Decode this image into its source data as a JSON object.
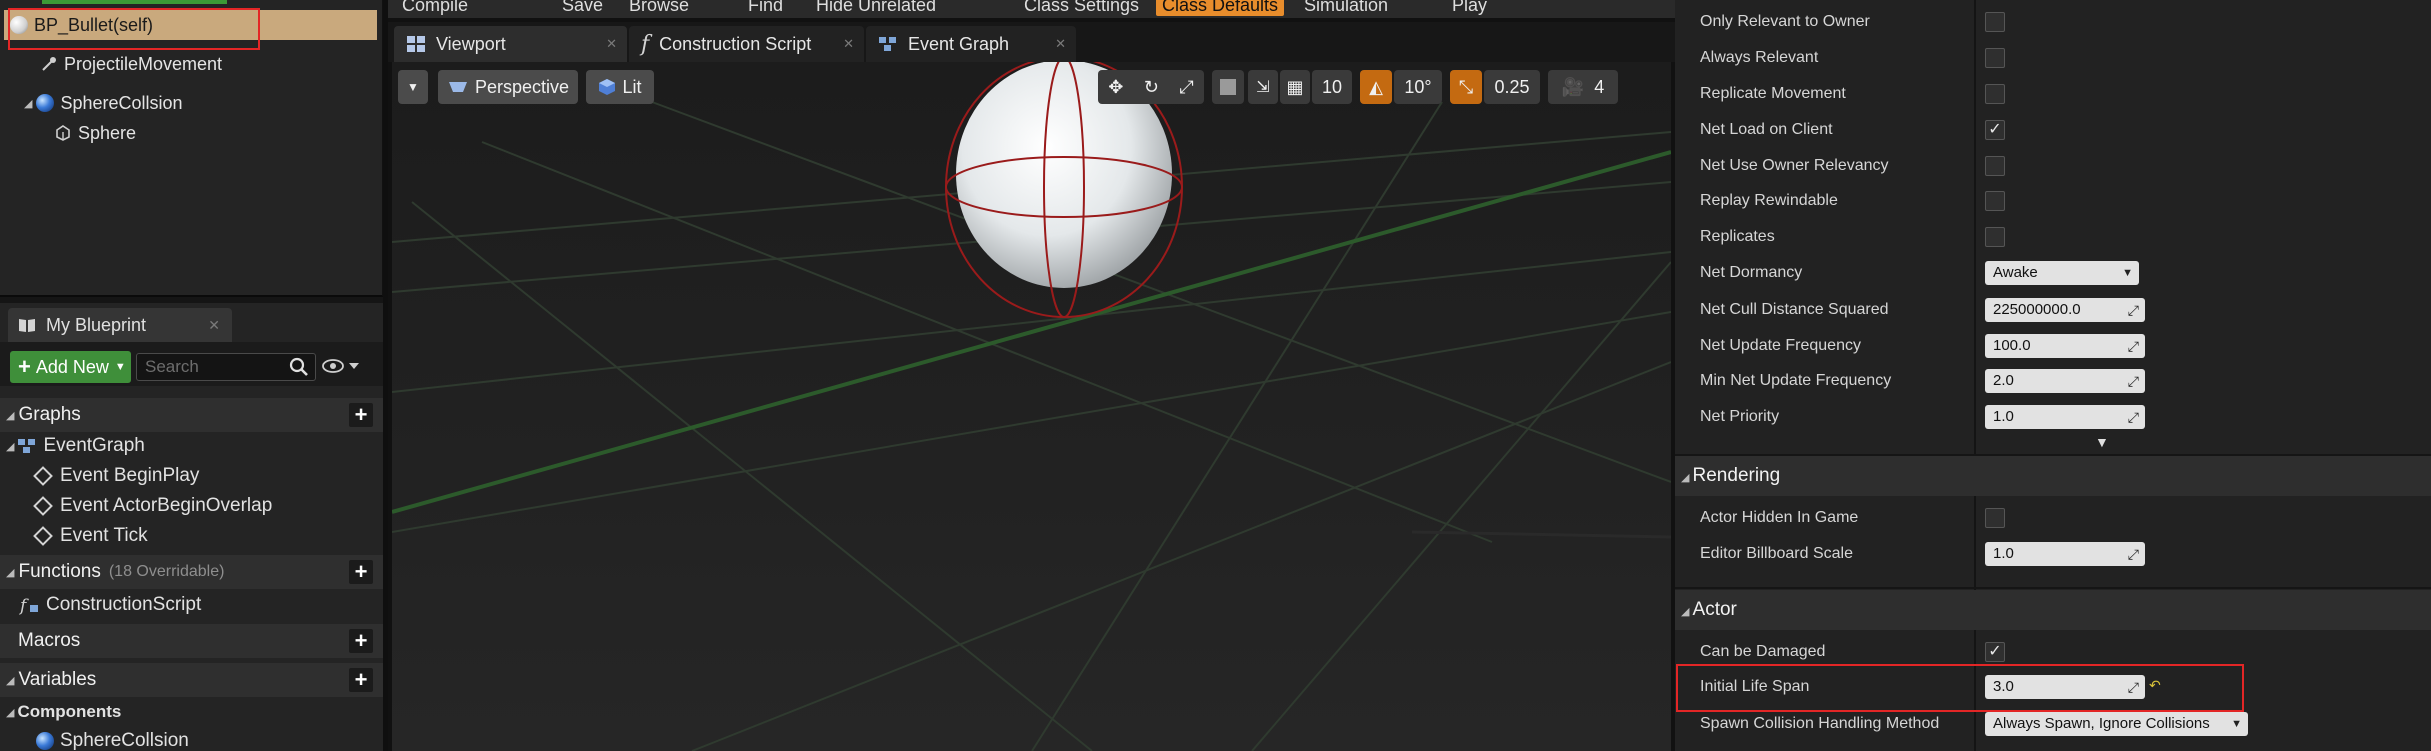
{
  "components": {
    "root": "BP_Bullet(self)",
    "items": [
      {
        "label": "ProjectileMovement"
      },
      {
        "label": "SphereCollsion"
      },
      {
        "label": "Sphere"
      }
    ]
  },
  "top_toolbar": {
    "buttons": [
      "Compile",
      "Save",
      "Browse",
      "Find",
      "Hide Unrelated",
      "Class Settings",
      "Class Defaults",
      "Simulation",
      "Play"
    ]
  },
  "editor_tabs": [
    {
      "label": "Viewport"
    },
    {
      "label": "Construction Script"
    },
    {
      "label": "Event Graph"
    }
  ],
  "viewport_toolbar": {
    "perspective": "Perspective",
    "lit": "Lit",
    "grid_snap": "10",
    "rotation_snap": "10°",
    "scale_snap": "0.25",
    "camera_speed": "4"
  },
  "my_blueprint": {
    "tab": "My Blueprint",
    "add_new": "Add New",
    "search_placeholder": "Search",
    "graphs_title": "Graphs",
    "event_graph": "EventGraph",
    "events": [
      "Event BeginPlay",
      "Event ActorBeginOverlap",
      "Event Tick"
    ],
    "functions_title": "Functions",
    "functions_sub": "(18 Overridable)",
    "construction_script": "ConstructionScript",
    "macros_title": "Macros",
    "variables_title": "Variables",
    "components_title": "Components",
    "component_var": "SphereCollsion"
  },
  "details": {
    "replication": [
      {
        "label": "Only Relevant to Owner",
        "type": "checkbox",
        "checked": false
      },
      {
        "label": "Always Relevant",
        "type": "checkbox",
        "checked": false
      },
      {
        "label": "Replicate Movement",
        "type": "checkbox",
        "checked": false
      },
      {
        "label": "Net Load on Client",
        "type": "checkbox",
        "checked": true
      },
      {
        "label": "Net Use Owner Relevancy",
        "type": "checkbox",
        "checked": false
      },
      {
        "label": "Replay Rewindable",
        "type": "checkbox",
        "checked": false
      },
      {
        "label": "Replicates",
        "type": "checkbox",
        "checked": false
      },
      {
        "label": "Net Dormancy",
        "type": "dropdown",
        "value": "Awake"
      },
      {
        "label": "Net Cull Distance Squared",
        "type": "number",
        "value": "225000000.0"
      },
      {
        "label": "Net Update Frequency",
        "type": "number",
        "value": "100.0"
      },
      {
        "label": "Min Net Update Frequency",
        "type": "number",
        "value": "2.0"
      },
      {
        "label": "Net Priority",
        "type": "number",
        "value": "1.0"
      }
    ],
    "rendering_title": "Rendering",
    "rendering": [
      {
        "label": "Actor Hidden In Game",
        "type": "checkbox",
        "checked": false
      },
      {
        "label": "Editor Billboard Scale",
        "type": "number",
        "value": "1.0"
      }
    ],
    "actor_title": "Actor",
    "actor": [
      {
        "label": "Can be Damaged",
        "type": "checkbox",
        "checked": true
      },
      {
        "label": "Initial Life Span",
        "type": "number",
        "value": "3.0"
      },
      {
        "label": "Spawn Collision Handling Method",
        "type": "dropdown",
        "value": "Always Spawn, Ignore Collisions"
      }
    ]
  },
  "colors": {
    "accent_orange": "#e88d2c",
    "selection_tan": "#c9a97d",
    "add_green": "#3f8f3a",
    "highlight_red": "#e32626"
  }
}
